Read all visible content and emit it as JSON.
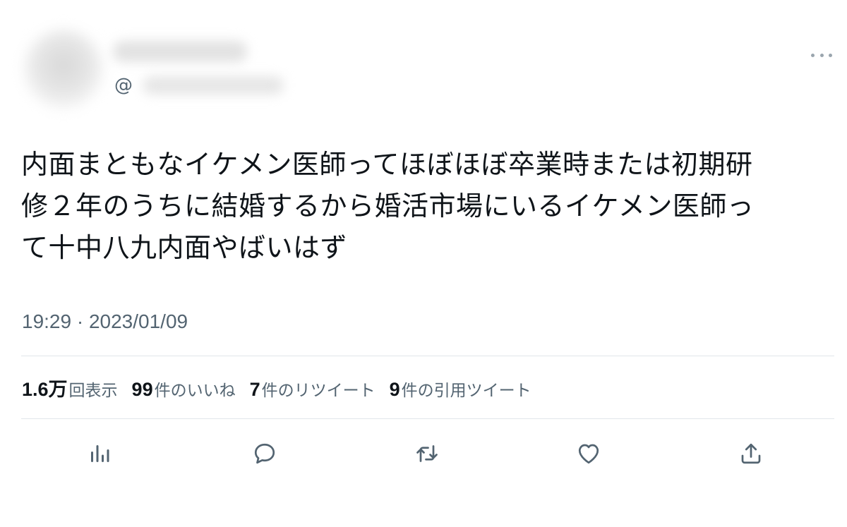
{
  "author": {
    "handle_prefix": "@"
  },
  "tweet": {
    "text_lines": [
      "内面まともなイケメン医師ってほぼほぼ卒業時または初期研",
      "修２年のうちに結婚するから婚活市場にいるイケメン医師っ",
      "て十中八九内面やばいはず"
    ],
    "timestamp": "19:29 · 2023/01/09"
  },
  "stats": {
    "views": {
      "count": "1.6万",
      "label": "回表示"
    },
    "likes": {
      "count": "99",
      "label": "件のいいね"
    },
    "retweets": {
      "count": "7",
      "label": "件のリツイート"
    },
    "quotes": {
      "count": "9",
      "label": "件の引用ツイート"
    }
  },
  "actions": [
    {
      "icon": "analytics-icon"
    },
    {
      "icon": "reply-icon"
    },
    {
      "icon": "retweet-icon"
    },
    {
      "icon": "like-icon"
    },
    {
      "icon": "share-icon"
    }
  ],
  "colors": {
    "text_primary": "#0f1419",
    "text_secondary": "#536471",
    "divider": "#e1e6ea"
  }
}
